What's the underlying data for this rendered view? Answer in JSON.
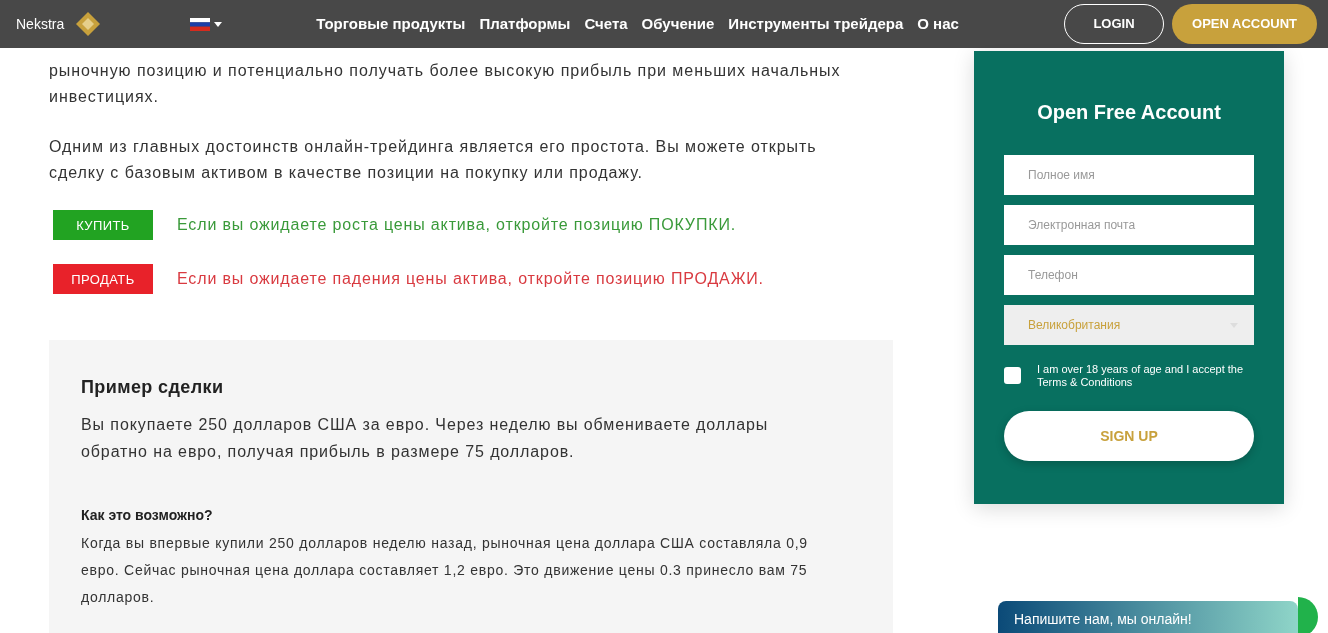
{
  "navbar": {
    "brand": "Nekstra",
    "menu": [
      {
        "label": "Торговые продукты"
      },
      {
        "label": "Платформы"
      },
      {
        "label": "Счета"
      },
      {
        "label": "Обучение"
      },
      {
        "label": "Инструменты трейдера"
      },
      {
        "label": "О нас"
      }
    ],
    "login": "LOGIN",
    "open_account": "OPEN ACCOUNT"
  },
  "intro": [
    "рыночную позицию и потенциально получать более высокую прибыль при меньших начальных инвестициях.",
    "Одним из главных достоинств онлайн-трейдинга является его простота. Вы можете открыть сделку с базовым активом в качестве позиции на покупку или продажу."
  ],
  "actions": [
    {
      "kind": "buy",
      "button": "КУПИТЬ",
      "text": "Если вы ожидаете роста цены актива, откройте позицию ПОКУПКИ."
    },
    {
      "kind": "sell",
      "button": "ПРОДАТЬ",
      "text": "Если вы ожидаете падения цены актива, откройте позицию ПРОДАЖИ."
    }
  ],
  "example": {
    "title": "Пример сделки",
    "text": "Вы покупаете 250 долларов США за евро. Через неделю вы обмениваете доллары обратно на евро, получая прибыль в размере 75 долларов.",
    "question": "Как это возможно?",
    "answer": "Когда вы впервые купили 250 долларов неделю назад, рыночная цена доллара США составляла 0,9 евро. Сейчас рыночная цена доллара составляет 1,2 евро. Это движение цены 0.3 принесло вам 75 долларов."
  },
  "form": {
    "title": "Open Free Account",
    "fields": [
      {
        "placeholder": "Полное имя"
      },
      {
        "placeholder": "Электронная почта"
      },
      {
        "placeholder": "Телефон"
      }
    ],
    "country": "Великобритания",
    "terms": {
      "label": "I am over 18 years of age and I accept the Terms & Conditions",
      "checked": false
    },
    "submit": "SIGN UP"
  },
  "chat": {
    "text": "Напишите нам, мы онлайн!"
  }
}
